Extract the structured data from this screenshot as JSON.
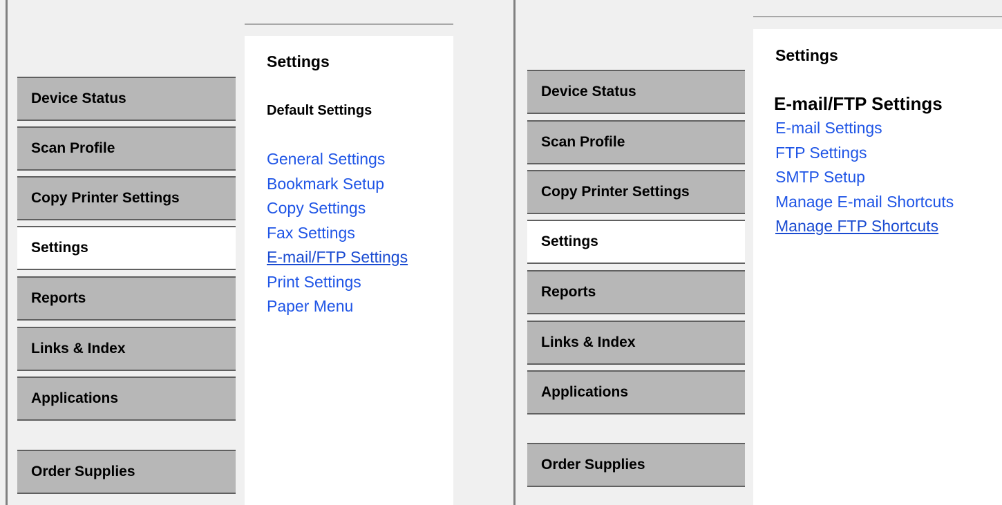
{
  "left_panel": {
    "nav": [
      {
        "label": "Device Status",
        "active": false
      },
      {
        "label": "Scan Profile",
        "active": false
      },
      {
        "label": "Copy Printer Settings",
        "active": false
      },
      {
        "label": "Settings",
        "active": true
      },
      {
        "label": "Reports",
        "active": false
      },
      {
        "label": "Links & Index",
        "active": false
      },
      {
        "label": "Applications",
        "active": false
      },
      {
        "label": "Order Supplies",
        "active": false
      }
    ],
    "title": "Settings",
    "subtitle": "Default Settings",
    "links": [
      {
        "label": "General Settings"
      },
      {
        "label": "Bookmark Setup"
      },
      {
        "label": "Copy Settings"
      },
      {
        "label": "Fax Settings"
      },
      {
        "label": "E-mail/FTP Settings",
        "underlined": true
      },
      {
        "label": "Print Settings"
      },
      {
        "label": "Paper Menu"
      }
    ]
  },
  "right_panel": {
    "nav": [
      {
        "label": "Device Status",
        "active": false
      },
      {
        "label": "Scan Profile",
        "active": false
      },
      {
        "label": "Copy Printer Settings",
        "active": false
      },
      {
        "label": "Settings",
        "active": true
      },
      {
        "label": "Reports",
        "active": false
      },
      {
        "label": "Links & Index",
        "active": false
      },
      {
        "label": "Applications",
        "active": false
      },
      {
        "label": "Order Supplies",
        "active": false
      }
    ],
    "title": "Settings",
    "subtitle": "E-mail/FTP Settings",
    "links": [
      {
        "label": "E-mail Settings"
      },
      {
        "label": "FTP Settings"
      },
      {
        "label": "SMTP Setup"
      },
      {
        "label": "Manage E-mail Shortcuts"
      },
      {
        "label": "Manage FTP Shortcuts",
        "underlined": true
      }
    ]
  },
  "colors": {
    "nav_bg": "#b7b7b7",
    "nav_active_bg": "#ffffff",
    "link": "#1f55e6",
    "page_bg": "#f0f0f0"
  }
}
